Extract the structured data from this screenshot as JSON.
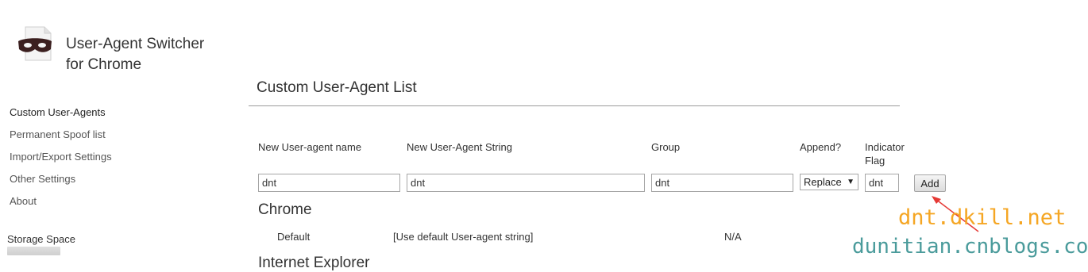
{
  "app": {
    "title_line1": "User-Agent Switcher",
    "title_line2": "for Chrome",
    "logo_icon": "bandit-mask-icon"
  },
  "sidebar": {
    "items": [
      {
        "label": "Custom User-Agents",
        "active": true
      },
      {
        "label": "Permanent Spoof list"
      },
      {
        "label": "Import/Export Settings"
      },
      {
        "label": "Other Settings"
      },
      {
        "label": "About"
      }
    ],
    "storage": {
      "label": "Storage Space"
    }
  },
  "main": {
    "title": "Custom User-Agent List",
    "columns": {
      "name": "New User-agent name",
      "string": "New User-Agent String",
      "group": "Group",
      "append": "Append?",
      "flag_line1": "Indicator",
      "flag_line2": "Flag"
    },
    "form": {
      "name_value": "dnt",
      "string_value": "dnt",
      "group_value": "dnt",
      "append_selected": "Replace",
      "flag_value": "dnt",
      "add_label": "Add"
    },
    "groups": [
      {
        "name": "Chrome",
        "rows": [
          {
            "name": "Default",
            "string": "[Use default User-agent string]",
            "flag": "N/A"
          }
        ]
      },
      {
        "name": "Internet Explorer"
      }
    ]
  },
  "watermark": {
    "line1": "dnt.dkill.net",
    "line2": "dunitian.cnblogs.com",
    "color1": "#f5a623",
    "color2": "#4a9b9b",
    "arrow_color": "#e53935"
  }
}
